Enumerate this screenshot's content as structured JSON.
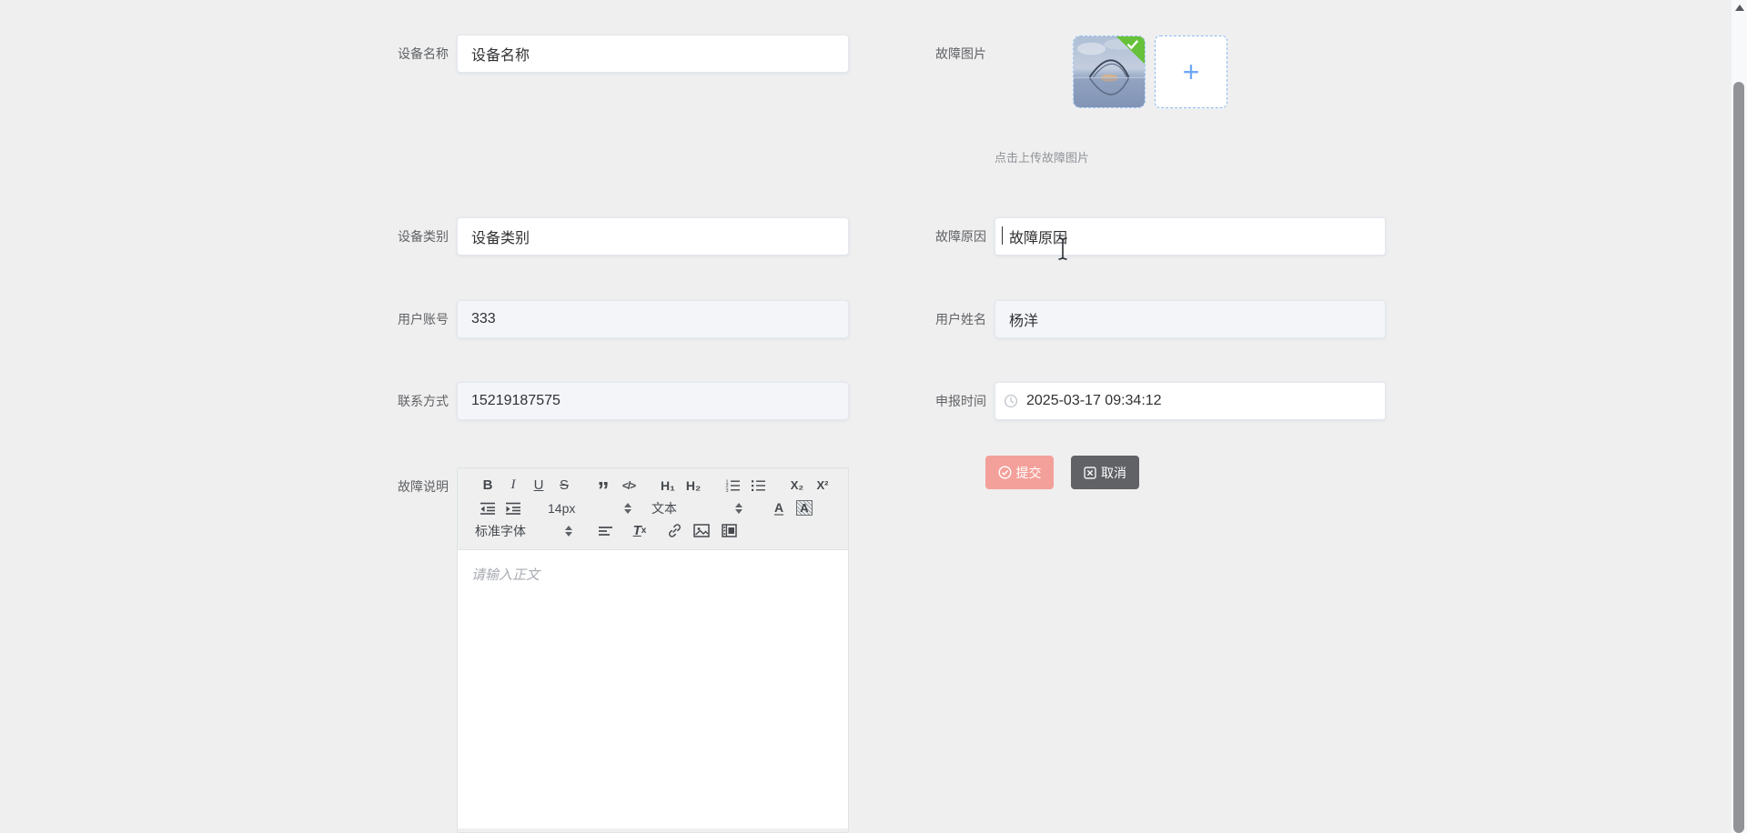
{
  "page": {
    "background": "#EFEFEF"
  },
  "form": {
    "device_name": {
      "label": "设备名称",
      "value": "设备名称"
    },
    "fault_image": {
      "label": "故障图片",
      "tip": "点击上传故障图片",
      "plus": "+"
    },
    "device_type": {
      "label": "设备类别",
      "value": "设备类别"
    },
    "fault_reason": {
      "label": "故障原因",
      "value": "故障原因"
    },
    "user_account": {
      "label": "用户账号",
      "value": "333"
    },
    "user_name": {
      "label": "用户姓名",
      "value": "杨洋"
    },
    "contact": {
      "label": "联系方式",
      "value": "15219187575"
    },
    "report_time": {
      "label": "申报时间",
      "value": "2025-03-17 09:34:12"
    },
    "fault_desc": {
      "label": "故障说明"
    }
  },
  "editor": {
    "placeholder": "请输入正文",
    "toolbar": {
      "bold": "B",
      "italic": "I",
      "underline": "U",
      "strike": "S",
      "blockquote": "”",
      "code": "</>",
      "header1": "H₁",
      "header2": "H₂",
      "subscript": "X₂",
      "superscript": "X²",
      "size": "14px",
      "format": "文本",
      "color": "A",
      "background": "A",
      "font": "标准字体",
      "clean_t": "T",
      "clean_x": "x"
    }
  },
  "actions": {
    "submit": "提交",
    "cancel": "取消"
  },
  "colors": {
    "submit_bg": "#F4A09A",
    "cancel_bg": "#606266",
    "upload_accent": "#6FA8F7",
    "badge_green": "#67C23A"
  }
}
